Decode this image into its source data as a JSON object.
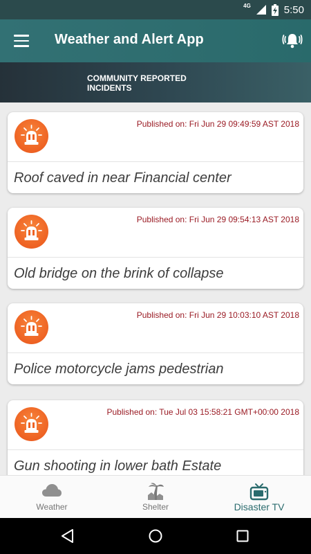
{
  "status_bar": {
    "network": "4G",
    "time": "5:50"
  },
  "app_bar": {
    "title": "Weather and Alert App"
  },
  "subheader": {
    "title": "COMMUNITY REPORTED INCIDENTS"
  },
  "incidents": [
    {
      "published": "Published on: Fri Jun 29 09:49:59 AST 2018",
      "title": "Roof caved in near Financial center"
    },
    {
      "published": "Published on: Fri Jun 29 09:54:13 AST 2018",
      "title": "Old bridge on the brink of collapse"
    },
    {
      "published": "Published on: Fri Jun 29 10:03:10 AST 2018",
      "title": "Police motorcycle jams pedestrian"
    },
    {
      "published": "Published on: Tue Jul 03 15:58:21 GMT+00:00 2018",
      "title": "Gun shooting in lower bath Estate"
    }
  ],
  "bottom_nav": {
    "items": [
      {
        "label": "Weather",
        "icon": "cloud-icon"
      },
      {
        "label": "Shelter",
        "icon": "shelter-icon"
      },
      {
        "label": "Disaster TV",
        "icon": "tv-icon"
      }
    ],
    "active": "Disaster TV"
  },
  "colors": {
    "app_bar": "#2e6d6f",
    "status_bar": "#2b4a4c",
    "alert_icon": "#ee6223",
    "published_text": "#9a1b24",
    "active_nav": "#2a6b6d"
  }
}
